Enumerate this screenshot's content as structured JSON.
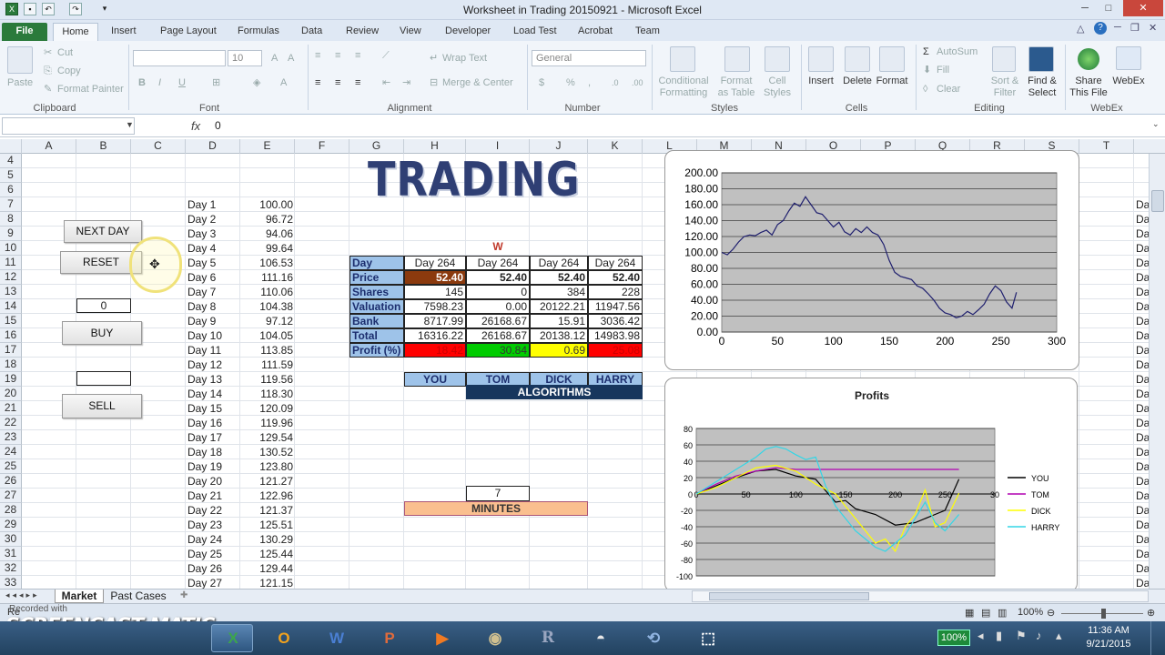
{
  "window": {
    "title": "Worksheet in Trading 20150921  -  Microsoft Excel"
  },
  "ribbon_tabs": [
    "File",
    "Home",
    "Insert",
    "Page Layout",
    "Formulas",
    "Data",
    "Review",
    "View",
    "Developer",
    "Load Test",
    "Acrobat",
    "Team"
  ],
  "ribbon": {
    "clipboard": {
      "paste": "Paste",
      "cut": "Cut",
      "copy": "Copy",
      "format_painter": "Format Painter",
      "group": "Clipboard"
    },
    "font": {
      "size": "10",
      "group": "Font"
    },
    "alignment": {
      "wrap": "Wrap Text",
      "merge": "Merge & Center",
      "group": "Alignment"
    },
    "number": {
      "format": "General",
      "group": "Number"
    },
    "styles": {
      "conditional": "Conditional",
      "conditional2": "Formatting",
      "format_table": "Format",
      "format_table2": "as Table",
      "cell_styles": "Cell",
      "cell_styles2": "Styles",
      "group": "Styles"
    },
    "cells": {
      "insert": "Insert",
      "delete": "Delete",
      "format": "Format",
      "group": "Cells"
    },
    "editing": {
      "autosum": "AutoSum",
      "fill": "Fill",
      "clear": "Clear",
      "sort": "Sort &",
      "sort2": "Filter",
      "find": "Find &",
      "find2": "Select",
      "group": "Editing"
    },
    "webex": {
      "share": "Share",
      "share2": "This File",
      "webex": "WebEx",
      "group": "WebEx"
    }
  },
  "formula_bar": {
    "fx": "fx",
    "value": "0"
  },
  "columns": [
    "A",
    "B",
    "C",
    "D",
    "E",
    "F",
    "G",
    "H",
    "I",
    "J",
    "K",
    "L",
    "M",
    "N",
    "O",
    "P",
    "Q",
    "R",
    "S",
    "T"
  ],
  "rows": [
    "4",
    "5",
    "6",
    "7",
    "8",
    "9",
    "10",
    "11",
    "12",
    "13",
    "14",
    "15",
    "16",
    "17",
    "18",
    "19",
    "20",
    "21",
    "22",
    "23",
    "24",
    "25",
    "26",
    "27",
    "28",
    "29",
    "30",
    "31",
    "32",
    "33"
  ],
  "controls": {
    "next_day": "NEXT DAY",
    "reset": "RESET",
    "shares_input": "0",
    "buy": "BUY",
    "sell": "SELL"
  },
  "prices": [
    [
      "Day 1",
      "100.00"
    ],
    [
      "Day 2",
      "96.72"
    ],
    [
      "Day 3",
      "94.06"
    ],
    [
      "Day 4",
      "99.64"
    ],
    [
      "Day 5",
      "106.53"
    ],
    [
      "Day 6",
      "111.16"
    ],
    [
      "Day 7",
      "110.06"
    ],
    [
      "Day 8",
      "104.38"
    ],
    [
      "Day 9",
      "97.12"
    ],
    [
      "Day 10",
      "104.05"
    ],
    [
      "Day 11",
      "113.85"
    ],
    [
      "Day 12",
      "111.59"
    ],
    [
      "Day 13",
      "119.56"
    ],
    [
      "Day 14",
      "118.30"
    ],
    [
      "Day 15",
      "120.09"
    ],
    [
      "Day 16",
      "119.96"
    ],
    [
      "Day 17",
      "129.54"
    ],
    [
      "Day 18",
      "130.52"
    ],
    [
      "Day 19",
      "123.80"
    ],
    [
      "Day 20",
      "121.27"
    ],
    [
      "Day 21",
      "122.96"
    ],
    [
      "Day 22",
      "121.37"
    ],
    [
      "Day 23",
      "125.51"
    ],
    [
      "Day 24",
      "130.29"
    ],
    [
      "Day 25",
      "125.44"
    ],
    [
      "Day 26",
      "129.44"
    ],
    [
      "Day 27",
      "121.15"
    ]
  ],
  "banner": "TRADING",
  "marker": "W",
  "table": {
    "labels": [
      "Day",
      "Price",
      "Shares",
      "Valuation",
      "Bank",
      "Total",
      "Profit (%)"
    ],
    "cols": [
      [
        "Day 264",
        "52.40",
        "145",
        "7598.23",
        "8717.99",
        "16316.22",
        "18.42"
      ],
      [
        "Day 264",
        "52.40",
        "0",
        "0.00",
        "26168.67",
        "26168.67",
        "30.84"
      ],
      [
        "Day 264",
        "52.40",
        "384",
        "20122.21",
        "15.91",
        "20138.12",
        "0.69"
      ],
      [
        "Day 264",
        "52.40",
        "228",
        "11947.56",
        "3036.42",
        "14983.98",
        "25.08"
      ]
    ],
    "players": [
      "YOU",
      "TOM",
      "DICK",
      "HARRY"
    ],
    "algorithms": "ALGORITHMS",
    "minutes_value": "7",
    "minutes_label": "MINUTES",
    "profit_colors": [
      "#ff0000",
      "#00cc00",
      "#ffff00",
      "#ff0000"
    ],
    "price_you_color": "#8b3a0e"
  },
  "chart_data": [
    {
      "type": "line",
      "title": "",
      "xlim": [
        0,
        300
      ],
      "ylim": [
        0,
        200
      ],
      "x_ticks": [
        "0",
        "50",
        "100",
        "150",
        "200",
        "250",
        "300"
      ],
      "y_ticks": [
        "0.00",
        "20.00",
        "40.00",
        "60.00",
        "80.00",
        "100.00",
        "120.00",
        "140.00",
        "160.00",
        "180.00",
        "200.00"
      ],
      "series": [
        {
          "color": "#1f1f6e",
          "points": [
            [
              0,
              100
            ],
            [
              5,
              97
            ],
            [
              10,
              104
            ],
            [
              15,
              113
            ],
            [
              20,
              120
            ],
            [
              25,
              122
            ],
            [
              30,
              121
            ],
            [
              35,
              125
            ],
            [
              40,
              128
            ],
            [
              45,
              122
            ],
            [
              50,
              135
            ],
            [
              55,
              140
            ],
            [
              60,
              152
            ],
            [
              65,
              162
            ],
            [
              70,
              158
            ],
            [
              75,
              170
            ],
            [
              80,
              160
            ],
            [
              85,
              150
            ],
            [
              90,
              148
            ],
            [
              95,
              140
            ],
            [
              100,
              132
            ],
            [
              105,
              138
            ],
            [
              110,
              126
            ],
            [
              115,
              122
            ],
            [
              120,
              130
            ],
            [
              125,
              125
            ],
            [
              130,
              132
            ],
            [
              135,
              125
            ],
            [
              140,
              122
            ],
            [
              145,
              110
            ],
            [
              150,
              90
            ],
            [
              155,
              75
            ],
            [
              160,
              70
            ],
            [
              165,
              68
            ],
            [
              170,
              66
            ],
            [
              175,
              58
            ],
            [
              180,
              55
            ],
            [
              185,
              48
            ],
            [
              190,
              40
            ],
            [
              195,
              30
            ],
            [
              200,
              24
            ],
            [
              205,
              22
            ],
            [
              210,
              18
            ],
            [
              215,
              20
            ],
            [
              220,
              26
            ],
            [
              225,
              22
            ],
            [
              230,
              28
            ],
            [
              235,
              35
            ],
            [
              240,
              48
            ],
            [
              245,
              58
            ],
            [
              250,
              52
            ],
            [
              255,
              38
            ],
            [
              260,
              30
            ],
            [
              264,
              50
            ]
          ]
        }
      ]
    },
    {
      "type": "line",
      "title": "Profits",
      "xlim": [
        0,
        300
      ],
      "ylim": [
        -100,
        80
      ],
      "x_ticks": [
        "0",
        "50",
        "100",
        "150",
        "200",
        "250",
        "30"
      ],
      "y_ticks": [
        "-100",
        "-80",
        "-60",
        "-40",
        "-20",
        "0",
        "20",
        "40",
        "60",
        "80"
      ],
      "legend_position": "right",
      "series": [
        {
          "name": "YOU",
          "color": "#000000",
          "points": [
            [
              0,
              0
            ],
            [
              20,
              10
            ],
            [
              40,
              20
            ],
            [
              60,
              28
            ],
            [
              80,
              30
            ],
            [
              100,
              22
            ],
            [
              120,
              18
            ],
            [
              140,
              -10
            ],
            [
              150,
              -8
            ],
            [
              160,
              -18
            ],
            [
              180,
              -25
            ],
            [
              200,
              -38
            ],
            [
              220,
              -35
            ],
            [
              240,
              -25
            ],
            [
              250,
              -20
            ],
            [
              264,
              18
            ]
          ]
        },
        {
          "name": "TOM",
          "color": "#b000b0",
          "points": [
            [
              0,
              0
            ],
            [
              20,
              12
            ],
            [
              40,
              22
            ],
            [
              60,
              28
            ],
            [
              80,
              32
            ],
            [
              100,
              30
            ],
            [
              120,
              30
            ],
            [
              140,
              30
            ],
            [
              160,
              30
            ],
            [
              180,
              30
            ],
            [
              200,
              30
            ],
            [
              220,
              30
            ],
            [
              240,
              30
            ],
            [
              264,
              30
            ]
          ]
        },
        {
          "name": "DICK",
          "color": "#ffff00",
          "points": [
            [
              0,
              0
            ],
            [
              20,
              8
            ],
            [
              40,
              20
            ],
            [
              60,
              32
            ],
            [
              80,
              35
            ],
            [
              100,
              28
            ],
            [
              120,
              12
            ],
            [
              140,
              0
            ],
            [
              150,
              -15
            ],
            [
              160,
              -30
            ],
            [
              170,
              -45
            ],
            [
              180,
              -60
            ],
            [
              190,
              -55
            ],
            [
              200,
              -70
            ],
            [
              210,
              -40
            ],
            [
              220,
              -25
            ],
            [
              230,
              5
            ],
            [
              240,
              -40
            ],
            [
              250,
              -35
            ],
            [
              264,
              1
            ]
          ]
        },
        {
          "name": "HARRY",
          "color": "#33d6e6",
          "points": [
            [
              0,
              0
            ],
            [
              20,
              15
            ],
            [
              40,
              30
            ],
            [
              60,
              45
            ],
            [
              70,
              55
            ],
            [
              80,
              58
            ],
            [
              90,
              55
            ],
            [
              100,
              48
            ],
            [
              110,
              42
            ],
            [
              120,
              45
            ],
            [
              130,
              10
            ],
            [
              140,
              -15
            ],
            [
              150,
              -30
            ],
            [
              160,
              -45
            ],
            [
              170,
              -55
            ],
            [
              180,
              -65
            ],
            [
              190,
              -70
            ],
            [
              200,
              -60
            ],
            [
              210,
              -50
            ],
            [
              220,
              -30
            ],
            [
              230,
              -10
            ],
            [
              240,
              -35
            ],
            [
              250,
              -45
            ],
            [
              264,
              -25
            ]
          ]
        }
      ]
    }
  ],
  "sheets": [
    "Market",
    "Past Cases"
  ],
  "status": {
    "zoom": "100%",
    "ready": "Re"
  },
  "watermark": "SCREENCAST  MATIC",
  "watermark_sub": "Recorded with",
  "taskbar": {
    "battery": "100%",
    "time": "11:36 AM",
    "date": "9/21/2015"
  }
}
